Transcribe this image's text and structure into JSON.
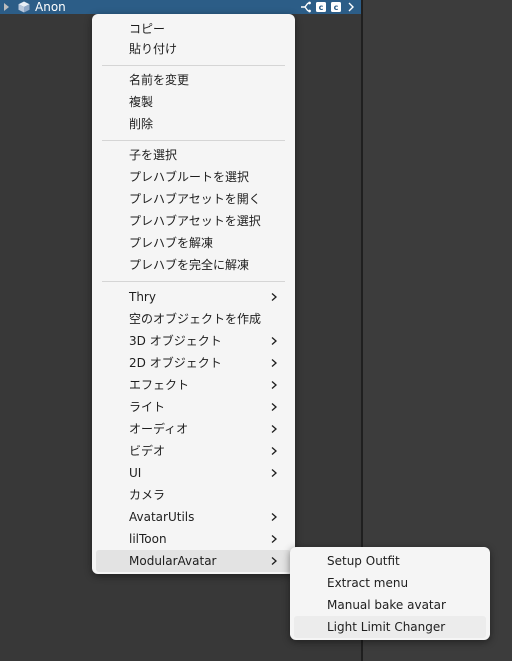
{
  "hierarchy": {
    "object_name": "Anon",
    "selection_color": "#2c5d87"
  },
  "menu": {
    "items": [
      {
        "label": "コピー"
      },
      {
        "label": "貼り付け"
      },
      {
        "label": "名前を変更"
      },
      {
        "label": "複製"
      },
      {
        "label": "削除"
      },
      {
        "label": "子を選択"
      },
      {
        "label": "プレハブルートを選択"
      },
      {
        "label": "プレハブアセットを開く"
      },
      {
        "label": "プレハブアセットを選択"
      },
      {
        "label": "プレハブを解凍"
      },
      {
        "label": "プレハブを完全に解凍"
      },
      {
        "label": "Thry",
        "submenu": true
      },
      {
        "label": "空のオブジェクトを作成"
      },
      {
        "label": "3D オブジェクト",
        "submenu": true
      },
      {
        "label": "2D オブジェクト",
        "submenu": true
      },
      {
        "label": "エフェクト",
        "submenu": true
      },
      {
        "label": "ライト",
        "submenu": true
      },
      {
        "label": "オーディオ",
        "submenu": true
      },
      {
        "label": "ビデオ",
        "submenu": true
      },
      {
        "label": "UI",
        "submenu": true
      },
      {
        "label": "カメラ"
      },
      {
        "label": "AvatarUtils",
        "submenu": true
      },
      {
        "label": "lilToon",
        "submenu": true
      },
      {
        "label": "ModularAvatar",
        "submenu": true,
        "state": "active"
      }
    ]
  },
  "submenu": {
    "items": [
      {
        "label": "Setup Outfit"
      },
      {
        "label": "Extract menu"
      },
      {
        "label": "Manual bake avatar"
      },
      {
        "label": "Light Limit Changer",
        "state": "hover"
      }
    ]
  }
}
